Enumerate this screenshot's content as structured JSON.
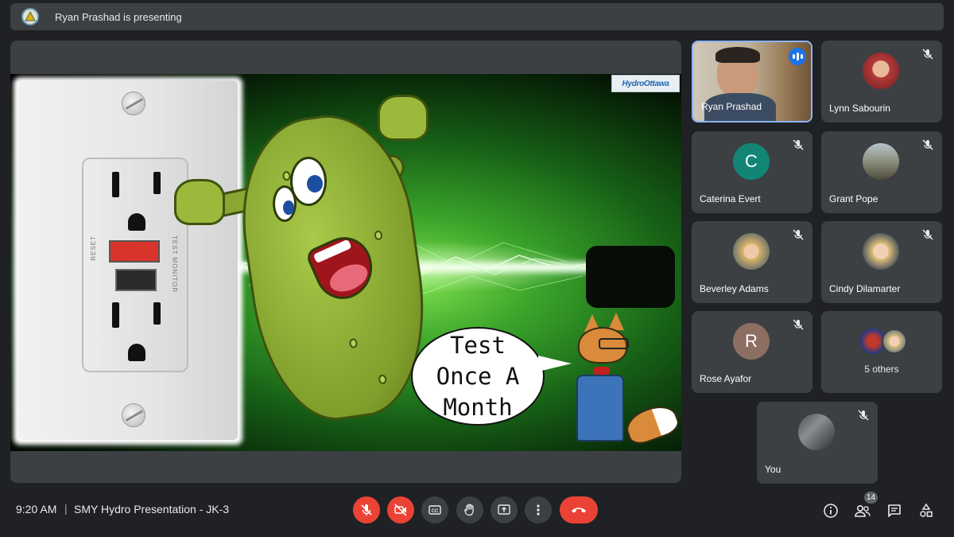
{
  "banner": {
    "text": "Ryan Prashad is presenting",
    "icon": "presenter-logo-icon"
  },
  "slide": {
    "logo_text": "HydroOttawa",
    "bubble_lines": [
      "Test",
      "Once A",
      "Month"
    ],
    "outlet_labels": [
      "TEST MONITOR",
      "RESET"
    ],
    "colors": {
      "background": "#1e7a1c",
      "pickle": "#8aa633",
      "test_button": "#d9342b"
    }
  },
  "participants": [
    {
      "name": "Ryan Prashad",
      "type": "video",
      "speaking": true,
      "muted": false
    },
    {
      "name": "Lynn Sabourin",
      "type": "photo",
      "muted": true
    },
    {
      "name": "Caterina Evert",
      "type": "initial",
      "initial": "C",
      "color": "#128577",
      "muted": true
    },
    {
      "name": "Grant Pope",
      "type": "photo",
      "muted": true
    },
    {
      "name": "Beverley Adams",
      "type": "photo",
      "muted": true
    },
    {
      "name": "Cindy Dilamarter",
      "type": "photo",
      "muted": true
    },
    {
      "name": "Rose Ayafor",
      "type": "initial",
      "initial": "R",
      "color": "#8d6e63",
      "muted": true
    },
    {
      "name": "5 others",
      "type": "group",
      "muted": false
    },
    {
      "name": "You",
      "type": "photo",
      "muted": true
    }
  ],
  "footer": {
    "time": "9:20 AM",
    "separator": "|",
    "meeting_title": "SMY Hydro Presentation - JK-3",
    "controls": [
      "mic-off-icon",
      "camera-off-icon",
      "captions-icon",
      "raise-hand-icon",
      "present-screen-icon",
      "more-options-icon",
      "end-call-icon"
    ],
    "right_icons": [
      "info-icon",
      "people-icon",
      "chat-icon",
      "activities-icon"
    ],
    "people_count": "14"
  },
  "colors": {
    "background": "#202124",
    "tile": "#3c4043",
    "danger": "#ea4335",
    "accent": "#1a73e8"
  }
}
